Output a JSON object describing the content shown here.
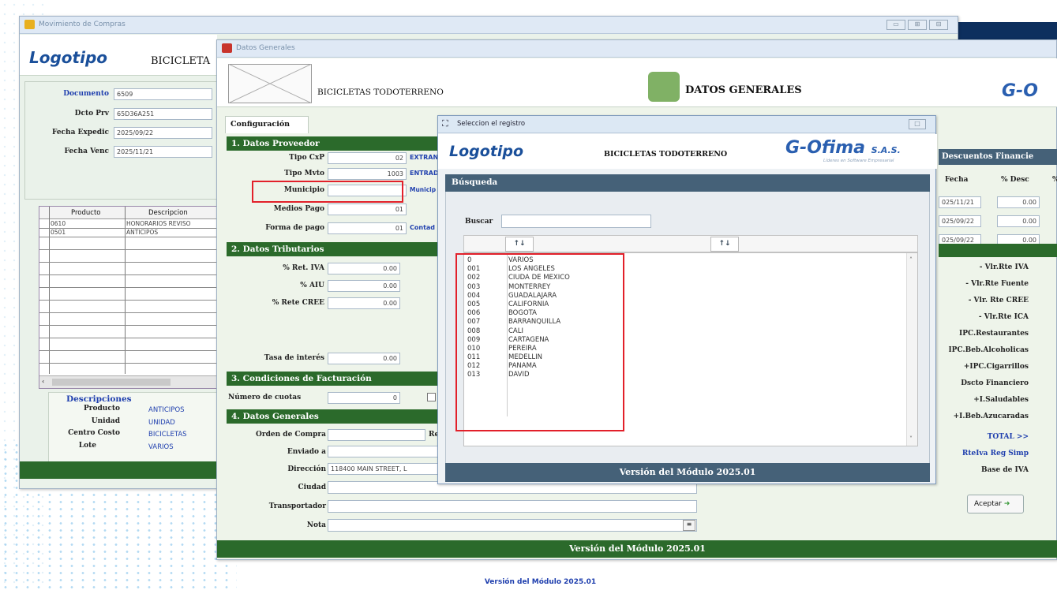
{
  "back_window": {
    "title": "Movimiento de Compras",
    "logo": "Logotipo",
    "company": "BICICLETA",
    "fields": [
      {
        "label": "Documento",
        "value": "6509"
      },
      {
        "label": "Dcto Prv",
        "value": "65D36A251"
      },
      {
        "label": "Fecha Expedic",
        "value": "2025/09/22"
      },
      {
        "label": "Fecha Venc",
        "value": "2025/11/21"
      }
    ],
    "table_headers": [
      "Producto",
      "Descripcion"
    ],
    "rows": [
      {
        "producto": "0610",
        "descripcion": "HONORARIOS REVISO"
      },
      {
        "producto": "0501",
        "descripcion": "ANTICIPOS"
      }
    ],
    "descripciones_title": "Descripciones",
    "descripciones": [
      {
        "label": "Producto",
        "value": "ANTICIPOS"
      },
      {
        "label": "Unidad",
        "value": "UNIDAD"
      },
      {
        "label": "Centro Costo",
        "value": "BICICLETAS"
      },
      {
        "label": "Lote",
        "value": "VARIOS"
      }
    ],
    "window_buttons": [
      "▭",
      "⊞",
      "⊟"
    ]
  },
  "mid_window": {
    "title": "Datos Generales",
    "company": "BICICLETAS TODOTERRENO",
    "header_title": "DATOS GENERALES",
    "tab": "Configuración",
    "sec1": "1. Datos Proveedor",
    "proveedor": [
      {
        "label": "Tipo CxP",
        "value": "02",
        "link": "EXTRAN"
      },
      {
        "label": "Tipo Mvto",
        "value": "1003",
        "link": "ENTRAD"
      },
      {
        "label": "Municipio",
        "value": "",
        "link": "Municip"
      },
      {
        "label": "Medios Pago",
        "value": "01",
        "link": ""
      },
      {
        "label": "Forma de pago",
        "value": "01",
        "link": "Contad"
      }
    ],
    "sec2": "2. Datos Tributarios",
    "tributarios": [
      {
        "label": "% Ret. IVA",
        "value": "0.00"
      },
      {
        "label": "% AIU",
        "value": "0.00"
      },
      {
        "label": "% Rete CREE",
        "value": "0.00"
      }
    ],
    "tasa_label": "Tasa de interés",
    "tasa_value": "0.00",
    "sec3": "3. Condiciones de Facturación",
    "cuotas_label": "Número de cuotas",
    "cuotas_value": "0",
    "sec4": "4. Datos Generales",
    "generales": [
      {
        "label": "Orden de Compra",
        "value": ""
      },
      {
        "label": "Enviado a",
        "value": ""
      },
      {
        "label": "Dirección",
        "value": "118400 MAIN STREET, L"
      },
      {
        "label": "Ciudad",
        "value": ""
      },
      {
        "label": "Transportador",
        "value": ""
      },
      {
        "label": "Nota",
        "value": ""
      }
    ],
    "orden_right": "Re",
    "descuentos_title": "Descuentos Financie",
    "desc_headers": [
      "Fecha",
      "% Desc",
      "%"
    ],
    "desc_rows": [
      {
        "fecha": "025/11/21",
        "desc": "0.00"
      },
      {
        "fecha": "025/09/22",
        "desc": "0.00"
      },
      {
        "fecha": "025/09/22",
        "desc": "0.00"
      }
    ],
    "totales": [
      "- Vlr.Rte IVA",
      "- Vlr.Rte Fuente",
      "- Vlr. Rte CREE",
      "- Vlr.Rte ICA",
      "IPC.Restaurantes",
      "IPC.Beb.Alcoholicas",
      "+IPC.Cigarrillos",
      "Dscto Financiero",
      "+I.Saludables",
      "+I.Beb.Azucaradas"
    ],
    "total_label": "TOTAL >>",
    "rteiva_label": "RteIva Reg Simp",
    "base_label": "Base de IVA",
    "aceptar": "Aceptar",
    "version": "Versión del Módulo 2025.01"
  },
  "dialog": {
    "title": "Seleccion el registro",
    "logo": "Logotipo",
    "company": "BICICLETAS TODOTERRENO",
    "ofima": "Ofima",
    "ofima_suffix": "S.A.S.",
    "ofima_tag": "Líderes en Software Empresarial",
    "search_section": "Búsqueda",
    "buscar_label": "Buscar",
    "buscar_value": "",
    "sort_icon": "↑↓",
    "items": [
      {
        "code": "0",
        "name": "VARIOS"
      },
      {
        "code": "001",
        "name": "LOS ANGELES"
      },
      {
        "code": "002",
        "name": "CIUDA DE MEXICO"
      },
      {
        "code": "003",
        "name": "MONTERREY"
      },
      {
        "code": "004",
        "name": "GUADALAJARA"
      },
      {
        "code": "005",
        "name": "CALIFORNIA"
      },
      {
        "code": "006",
        "name": "BOGOTA"
      },
      {
        "code": "007",
        "name": "BARRANQUILLA"
      },
      {
        "code": "008",
        "name": "CALI"
      },
      {
        "code": "009",
        "name": "CARTAGENA"
      },
      {
        "code": "010",
        "name": "PEREIRA"
      },
      {
        "code": "011",
        "name": "MEDELLIN"
      },
      {
        "code": "012",
        "name": "PANAMA"
      },
      {
        "code": "013",
        "name": "DAVID"
      }
    ],
    "version": "Versión del Módulo 2025.01"
  },
  "footer_version": "Versión del Módulo 2025.01",
  "colors": {
    "green": "#2b6a2b",
    "highlight": "#e2202a",
    "panel": "#eef4ea",
    "section_blue": "#456178"
  }
}
